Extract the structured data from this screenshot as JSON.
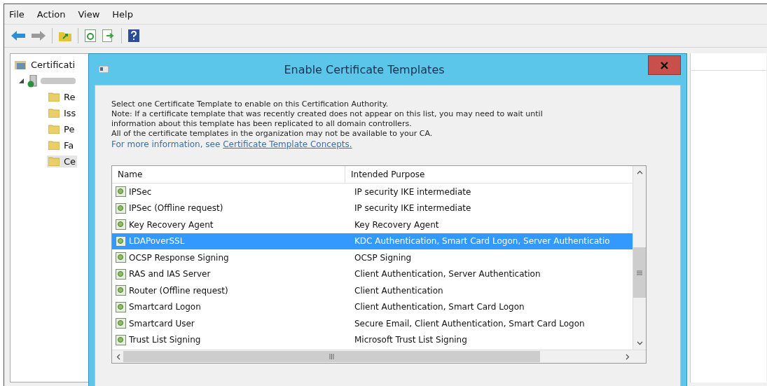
{
  "menu": [
    {
      "label": "File"
    },
    {
      "label": "Action"
    },
    {
      "label": "View"
    },
    {
      "label": "Help"
    }
  ],
  "tree": {
    "label": "Certificati",
    "children": [
      {
        "expanded": true,
        "children": [
          {
            "label": "Re",
            "selected": false
          },
          {
            "label": "Iss",
            "selected": false
          },
          {
            "label": "Pe",
            "selected": false
          },
          {
            "label": "Fa",
            "selected": false
          },
          {
            "label": "Ce",
            "selected": true
          }
        ]
      }
    ]
  },
  "dialog": {
    "title": "Enable Certificate Templates",
    "paragraphs": [
      "Select one Certificate Template to enable on this Certification Authority.",
      "Note: If a certificate template that was recently created does not appear on this list, you may need to wait until information about this template has been replicated to all domain controllers.",
      "All of the certificate templates in the organization may not be available to your CA."
    ],
    "more_info": {
      "text": "For more information, see ",
      "link": "Certificate Template Concepts."
    },
    "columns": [
      "Name",
      "Intended Purpose"
    ],
    "rows": [
      {
        "name": "IPSec",
        "purpose": "IP security IKE intermediate",
        "selected": false
      },
      {
        "name": "IPSec (Offline request)",
        "purpose": "IP security IKE intermediate",
        "selected": false
      },
      {
        "name": "Key Recovery Agent",
        "purpose": "Key Recovery Agent",
        "selected": false
      },
      {
        "name": "LDAPoverSSL",
        "purpose": "KDC Authentication, Smart Card Logon, Server Authenticatio",
        "selected": true
      },
      {
        "name": "OCSP Response Signing",
        "purpose": "OCSP Signing",
        "selected": false
      },
      {
        "name": "RAS and IAS Server",
        "purpose": "Client Authentication, Server Authentication",
        "selected": false
      },
      {
        "name": "Router (Offline request)",
        "purpose": "Client Authentication",
        "selected": false
      },
      {
        "name": "Smartcard Logon",
        "purpose": "Client Authentication, Smart Card Logon",
        "selected": false
      },
      {
        "name": "Smartcard User",
        "purpose": "Secure Email, Client Authentication, Smart Card Logon",
        "selected": false
      },
      {
        "name": "Trust List Signing",
        "purpose": "Microsoft Trust List Signing",
        "selected": false
      }
    ]
  }
}
